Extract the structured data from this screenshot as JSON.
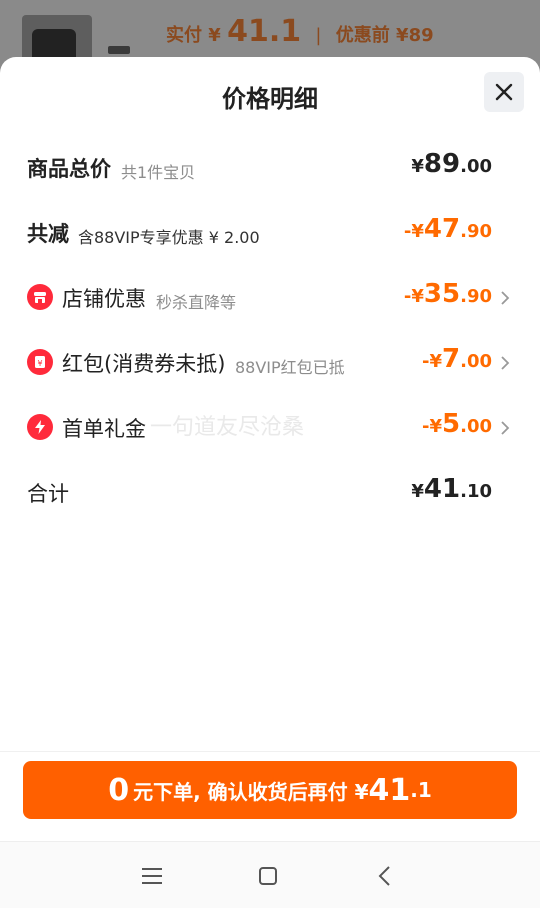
{
  "background": {
    "paid_label": "实付",
    "yen": "¥",
    "paid_amount": "41.1",
    "before_label": "优惠前",
    "before_amount": "¥89"
  },
  "sheet": {
    "title": "价格明细",
    "rows": [
      {
        "label": "商品总价",
        "sub": "共1件宝贝",
        "yen": "¥",
        "int": "89",
        "dec": ".00"
      },
      {
        "label": "共减",
        "sub": "含88VIP专享优惠 ¥ 2.00",
        "yen": "-¥",
        "int": "47",
        "dec": ".90"
      },
      {
        "label": "店铺优惠",
        "sub": "秒杀直降等",
        "yen": "-¥",
        "int": "35",
        "dec": ".90",
        "icon": "shop-icon"
      },
      {
        "label": "红包(消费券未抵)",
        "sub": "88VIP红包已抵",
        "yen": "-¥",
        "int": "7",
        "dec": ".00",
        "icon": "red-packet-icon"
      },
      {
        "label": "首单礼金",
        "sub": "",
        "yen": "-¥",
        "int": "5",
        "dec": ".00",
        "icon": "lightning-icon"
      },
      {
        "label": "合计",
        "sub": "",
        "yen": "¥",
        "int": "41",
        "dec": ".10"
      }
    ],
    "watermark": "一句道友尽沧桑"
  },
  "cta": {
    "zero": "0",
    "text": "元下单, 确认收货后再付 ¥",
    "amount_int": "41",
    "amount_dec": ".1"
  },
  "colors": {
    "accent": "#ff6000",
    "discount": "#ff6a00",
    "icon_red": "#ff2a3b"
  }
}
